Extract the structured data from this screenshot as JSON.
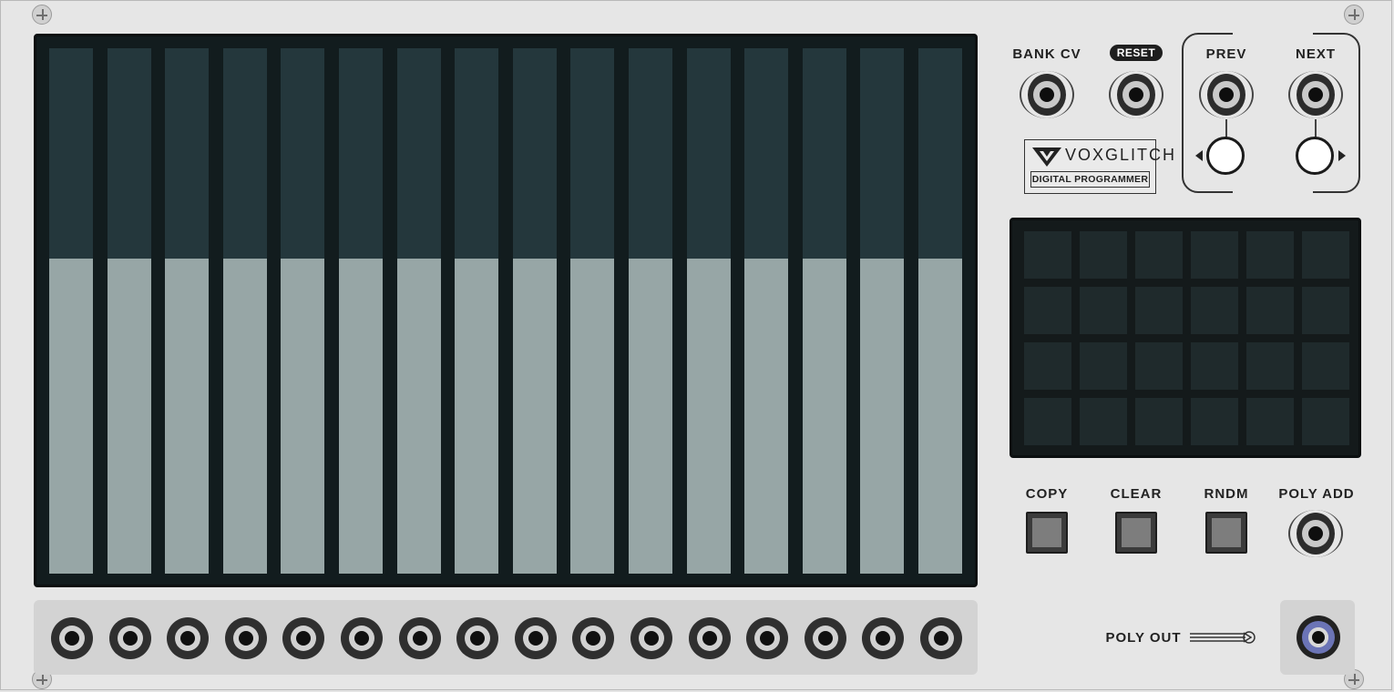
{
  "module": {
    "brand": "VOXGLITCH",
    "subtitle": "DIGITAL PROGRAMMER"
  },
  "top_controls": {
    "bank_cv_label": "BANK CV",
    "reset_label": "RESET",
    "prev_label": "PREV",
    "next_label": "NEXT"
  },
  "buttons": {
    "copy_label": "COPY",
    "clear_label": "CLEAR",
    "rndm_label": "RNDM",
    "poly_add_label": "POLY ADD"
  },
  "outputs": {
    "poly_out_label": "POLY OUT"
  },
  "sliders": {
    "count": 16,
    "values": [
      0.6,
      0.6,
      0.6,
      0.6,
      0.6,
      0.6,
      0.6,
      0.6,
      0.6,
      0.6,
      0.6,
      0.6,
      0.6,
      0.6,
      0.6,
      0.6
    ]
  },
  "bank_grid": {
    "rows": 4,
    "cols": 6
  },
  "colors": {
    "panel": "#e6e6e6",
    "slider_bg": "#24373c",
    "slider_fill": "#97a6a6",
    "display_bg": "#121c1e",
    "bank_cell": "#1f2a2c",
    "poly_out_ring": "#6b74b6"
  },
  "icons": {
    "logo": "voxglitch-logo-icon",
    "poly_out_arrow": "arrow-right-icon",
    "prev_arrow": "triangle-left-icon",
    "next_arrow": "triangle-right-icon"
  }
}
